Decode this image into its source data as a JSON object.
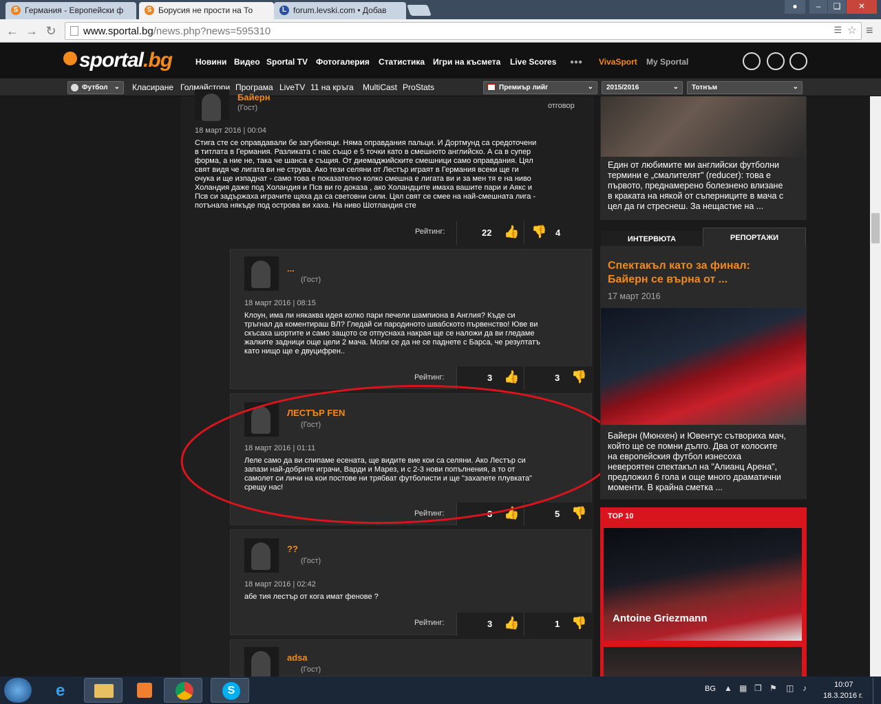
{
  "browser": {
    "tabs": [
      {
        "title": "Германия - Европейски ф",
        "fav": "S",
        "active": false
      },
      {
        "title": "Борусия не прости на То",
        "fav": "S",
        "active": true
      },
      {
        "title": "forum.levski.com • Добав",
        "fav": "L",
        "active": false
      }
    ],
    "url_host": "www.sportal.bg",
    "url_path": "/news.php?news=595310"
  },
  "site": {
    "logo_main": "sportal",
    "logo_tld": ".bg",
    "nav": [
      "Новини",
      "Видео",
      "Sportal TV",
      "Фотогалерия",
      "Статистика",
      "Игри на късмета",
      "Live Scores"
    ],
    "more": "●●●",
    "vivasport": "VivaSport",
    "my_sportal": "My Sportal",
    "sport_select": "Футбол",
    "subnav": [
      "Класиране",
      "Голмайстори",
      "Програма",
      "LiveTV",
      "11 на кръга",
      "MultiCast",
      "ProStats"
    ],
    "league_select": "Премиър лийг",
    "season_select": "2015/2016",
    "team_select": "Тотнъм"
  },
  "comments": [
    {
      "name": "Байерн",
      "guest": "(Гост)",
      "reply": "отговор",
      "date": "18 март 2016 | 00:04",
      "lines": [
        "Стига сте се оправдавали бе загубеняци. Няма оправдания пальци. И Дортмунд са средоточени",
        "в титлата в Германия. Разликата с нас също е 5 точки като в смешното английско. А са в супер",
        "форма, а ние не, така че шанса е същия. От диемаджийските смешници само оправдания. Цял",
        "свят видя че лигата ви не струва. Ако тези селяни от Лестър играят в Германия всеки ще ги",
        "очука и ще изпаднат - само това е показателно колко смешна е лигата ви и за мен тя е на ниво",
        "Холандия даже под Холандия и Псв ви го доказа , ако Холандците имаха вашите пари и Аякс и",
        "Псв си задържаха играчите щяха да са световни сили. Цял свят се смее на най-смешната лига -",
        "потънала някъде под острова ви хаха. На ниво Шотландия сте"
      ],
      "rating_label": "Рейтинг:",
      "up": "22",
      "down": "4"
    },
    {
      "name": "...",
      "guest": "(Гост)",
      "date": "18 март 2016 | 08:15",
      "lines": [
        "Клоун, има ли някаква идея колко пари печели шампиона в Англия? Къде си",
        "тръгнал да коментираш ВЛ? Гледай си пародиното швабското първенство! Юве ви",
        "скъсаха шортите и само защото се отпуснаха накрая ще се наложи да ви гледаме",
        "жалките задници още цели 2 мача. Моли се да не се паднете с Барса, че резултатъ",
        "като нищо ще е двуцифрен.."
      ],
      "rating_label": "Рейтинг:",
      "up": "3",
      "down": "3"
    },
    {
      "name": "ЛЕСТЪР FEN",
      "guest": "(Гост)",
      "date": "18 март 2016 | 01:11",
      "lines": [
        "Леле само да ви спипаме есената, ще видите вие кои са селяни. Ако Лестър си",
        "запази най-добрите играчи, Варди и Марез, и с 2-3 нови попълнения, а то от",
        "самолет си личи на кои постове ни трябват футболисти и ще \"захапете плувката\"",
        "срещу нас!"
      ],
      "rating_label": "Рейтинг:",
      "up": "3",
      "down": "5"
    },
    {
      "name": "??",
      "guest": "(Гост)",
      "date": "18 март 2016 | 02:42",
      "lines": [
        "абе тия лестър от кога имат фенове ?"
      ],
      "rating_label": "Рейтинг:",
      "up": "3",
      "down": "1"
    },
    {
      "name": "adsa",
      "guest": "(Гост)"
    }
  ],
  "sidebar": {
    "top_text_lines": [
      "Един от любимите ми английски футболни",
      "термини е „смалителят\" (reducer): това е",
      "първото, преднамерено болезнено влизане",
      "в краката на някой от съперниците в мача с",
      "цел да ги стреснеш. За нещастие на ..."
    ],
    "tab_interviews": "ИНТЕРВЮТА",
    "tab_reports": "РЕПОРТАЖИ",
    "report_title_1": "Спектакъл като за финал:",
    "report_title_2": "Байерн се върна от ...",
    "report_date": "17 март 2016",
    "report_lines": [
      "Байерн (Мюнхен) и Ювентус сътвориха мач,",
      "който ще се помни дълго. Два от колосите",
      "на европейския футбол изнесоха",
      "невероятен спектакъл на \"Алианц Арена\",",
      "предложил 6 гола и още много драматични",
      "моменти. В крайна сметка ..."
    ],
    "top10_label": "TOP 10",
    "top10_player": "Antoine Griezmann"
  },
  "taskbar": {
    "lang": "BG",
    "time": "10:07",
    "date": "18.3.2016 г."
  },
  "colors": {
    "accent": "#f28a1d",
    "annotation": "#d8141d"
  }
}
